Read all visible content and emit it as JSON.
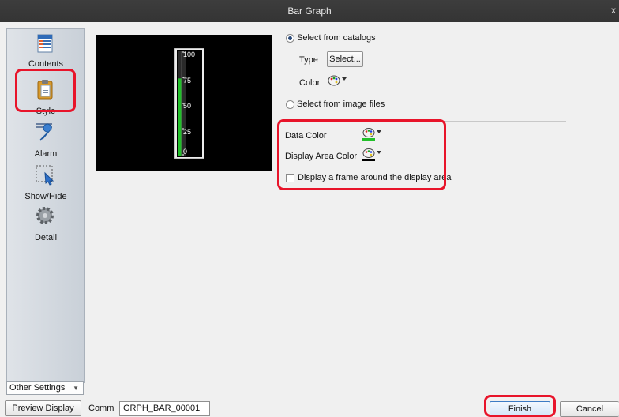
{
  "window": {
    "title": "Bar Graph",
    "close_glyph": "x"
  },
  "sidebar": {
    "items": [
      {
        "label": "Contents",
        "icon": "contents-icon"
      },
      {
        "label": "Style",
        "icon": "style-icon",
        "selected": true
      },
      {
        "label": "Alarm",
        "icon": "alarm-icon"
      },
      {
        "label": "Show/Hide",
        "icon": "show-hide-icon"
      },
      {
        "label": "Detail",
        "icon": "detail-icon"
      }
    ],
    "other_settings": "Other Settings"
  },
  "preview": {
    "scale": [
      "100",
      "75",
      "50",
      "25",
      "0"
    ],
    "bar_fill_fraction": 0.74,
    "bar_color": "#22c02a"
  },
  "style": {
    "catalog_radio": "Select from catalogs",
    "catalog_selected": true,
    "type_label": "Type",
    "select_button": "Select...",
    "color_label": "Color",
    "image_files_radio": "Select from image files",
    "data_color_label": "Data Color",
    "data_color": "#22c02a",
    "display_area_color_label": "Display Area Color",
    "display_area_color": "#000000",
    "frame_checkbox_label": "Display a frame around the display area",
    "frame_checked": false
  },
  "footer": {
    "preview_button": "Preview Display",
    "comm_label": "Comm",
    "comm_value": "GRPH_BAR_00001",
    "finish_button": "Finish",
    "cancel_button": "Cancel"
  },
  "colors": {
    "highlight": "#e8142a",
    "titlebar": "#3a3a3a"
  }
}
